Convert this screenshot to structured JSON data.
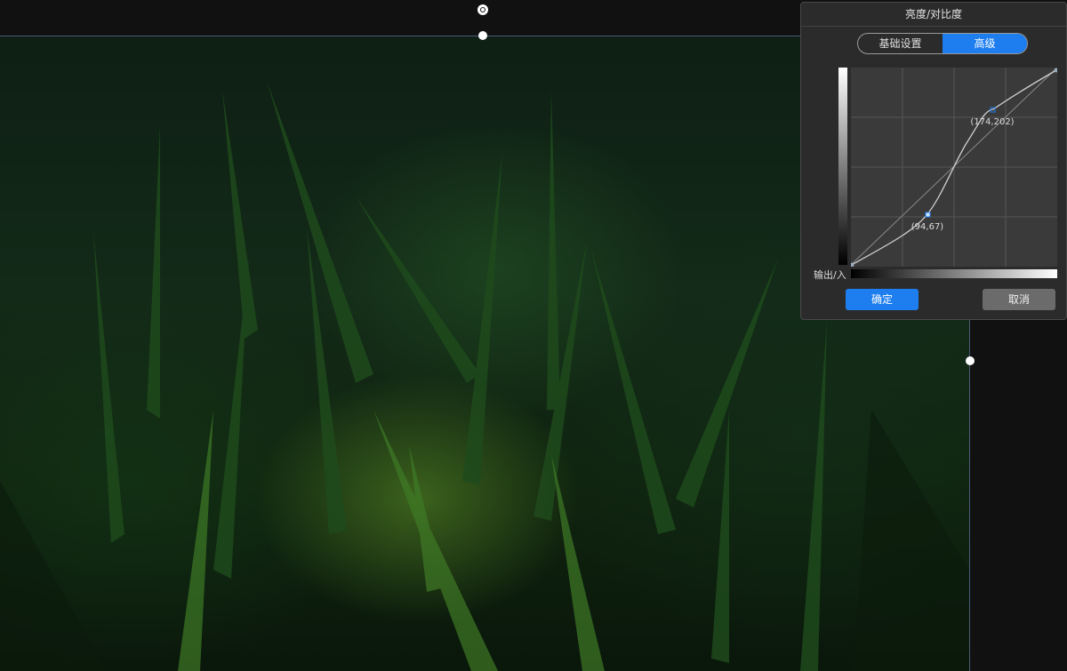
{
  "dialog": {
    "title": "亮度/对比度",
    "tabs": [
      {
        "label": "基础设置",
        "active": false
      },
      {
        "label": "高级",
        "active": true
      }
    ],
    "io_label": "输出/入",
    "curve_points": [
      {
        "label": "(94,67)",
        "input": 94,
        "output": 67
      },
      {
        "label": "(174,202)",
        "input": 174,
        "output": 202
      }
    ],
    "confirm_label": "确定",
    "cancel_label": "取消"
  },
  "colors": {
    "accent": "#1e7ef0",
    "dialog_bg": "#2b2b2b",
    "canvas_bg": "#111111"
  }
}
